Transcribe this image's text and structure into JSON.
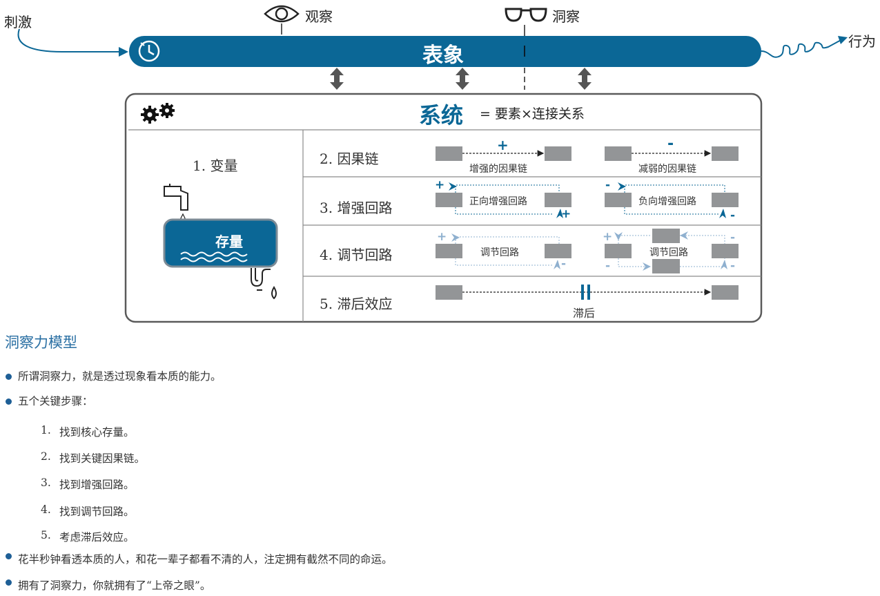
{
  "colors": {
    "primary": "#0b6796",
    "light": "#8fb0cf",
    "gray_box": "#939597",
    "frame": "#5a5a5a"
  },
  "icons": [
    "eye-icon",
    "glasses-icon",
    "clock-icon",
    "gears-icon",
    "faucet-icon",
    "drain-pipe-icon"
  ],
  "top": {
    "stimulus": "刺激",
    "observe": "观察",
    "insight": "洞察",
    "behavior": "行为",
    "phenomenon": "表象"
  },
  "system": {
    "title": "系统",
    "formula": "= 要素×连接关系",
    "variable_label": "1. 变量",
    "stock_label": "存量",
    "rows": [
      {
        "label": "2. 因果链",
        "left_caption": "增强的因果链",
        "right_caption": "减弱的因果链",
        "left_sign": "+",
        "right_sign": "-"
      },
      {
        "label": "3. 增强回路",
        "left_caption": "正向增强回路",
        "right_caption": "负向增强回路"
      },
      {
        "label": "4. 调节回路",
        "left_caption": "调节回路",
        "right_caption": "调节回路"
      },
      {
        "label": "5. 滞后效应",
        "delay_caption": "滞后"
      }
    ]
  },
  "notes": {
    "title": "洞察力模型",
    "bullets": [
      "所谓洞察力，就是透过现象看本质的能力。",
      "五个关键步骤："
    ],
    "steps": [
      {
        "num": "1.",
        "text": "找到核心存量。"
      },
      {
        "num": "2.",
        "text": "找到关键因果链。"
      },
      {
        "num": "3.",
        "text": "找到增强回路。"
      },
      {
        "num": "4.",
        "text": "找到调节回路。"
      },
      {
        "num": "5.",
        "text": "考虑滞后效应。"
      }
    ],
    "bullets_after": [
      "花半秒钟看透本质的人，和花一辈子都看不清的人，注定拥有截然不同的命运。",
      "拥有了洞察力，你就拥有了“上帝之眼”。"
    ]
  }
}
